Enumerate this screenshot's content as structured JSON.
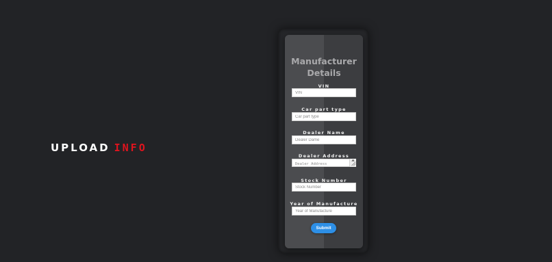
{
  "headline": {
    "text": "UPLOAD",
    "accent": "INFO",
    "accent_color": "#e0141e"
  },
  "form": {
    "title": "Manufacturer Details",
    "fields": [
      {
        "label": "VIN",
        "placeholder": "VIN",
        "value": ""
      },
      {
        "label": "Car part type",
        "placeholder": "Car part type",
        "value": ""
      },
      {
        "label": "Dealer Name",
        "placeholder": "Dealer Dame",
        "value": ""
      },
      {
        "label": "Dealer Address",
        "placeholder": "Dealer Address",
        "value": ""
      },
      {
        "label": "Stock Number",
        "placeholder": "Stock Number",
        "value": ""
      },
      {
        "label": "Year of Manufacture",
        "placeholder": "Year of Manufacture",
        "value": ""
      }
    ],
    "submit_label": "Submit",
    "submit_color": "#2d8fe6"
  },
  "icons": {
    "textarea_resize": "resize-handle-icon"
  }
}
